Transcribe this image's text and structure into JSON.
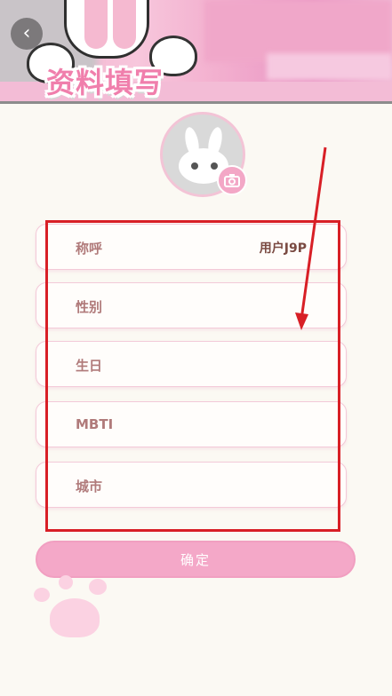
{
  "header": {
    "title": "资料填写",
    "back_icon": "chevron-left-icon"
  },
  "avatar": {
    "camera_icon": "camera-icon"
  },
  "form": {
    "fields": [
      {
        "label": "称呼",
        "value": "用户J9P"
      },
      {
        "label": "性别",
        "value": ""
      },
      {
        "label": "生日",
        "value": ""
      },
      {
        "label": "MBTI",
        "value": ""
      },
      {
        "label": "城市",
        "value": ""
      }
    ]
  },
  "confirm_button": {
    "label": "确定"
  },
  "colors": {
    "accent": "#f4a8c8",
    "label_text": "#b07a7a",
    "highlight_red": "#d81f26",
    "background": "#fbf9f3"
  }
}
